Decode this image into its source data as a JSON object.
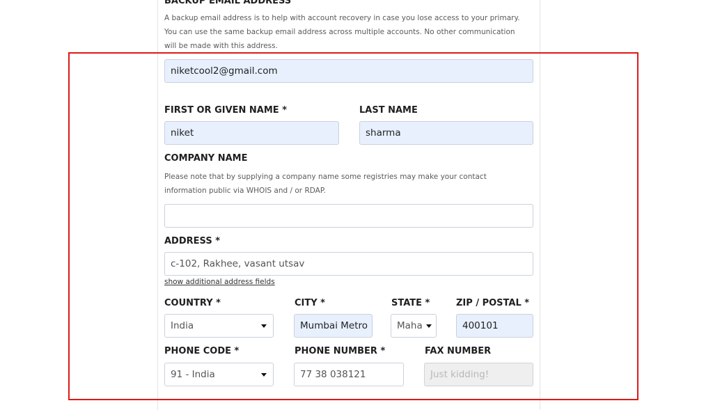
{
  "backup_email": {
    "heading": "BACKUP EMAIL ADDRESS",
    "help_line1": "A backup email address is to help with account recovery in case you lose access to your primary.",
    "help_line2": "You can use the same backup email address across multiple accounts. No other communication",
    "help_line3": "will be made with this address.",
    "value": "niketcool2@gmail.com"
  },
  "first_name": {
    "label": "FIRST OR GIVEN NAME *",
    "value": "niket"
  },
  "last_name": {
    "label": "LAST NAME",
    "value": "sharma"
  },
  "company": {
    "label": "COMPANY NAME",
    "help_line1": "Please note that by supplying a company name some registries may make your contact",
    "help_line2": "information public via WHOIS and / or RDAP.",
    "value": ""
  },
  "address": {
    "label": "ADDRESS *",
    "value": "c-102, Rakhee, vasant utsav",
    "more_link": "show additional address fields"
  },
  "country": {
    "label": "COUNTRY *",
    "value": "India"
  },
  "city": {
    "label": "CITY *",
    "value": "Mumbai Metro"
  },
  "state": {
    "label": "STATE *",
    "value": "Maha"
  },
  "zip": {
    "label": "ZIP / POSTAL *",
    "value": "400101"
  },
  "phone_code": {
    "label": "PHONE CODE *",
    "value": "91 - India"
  },
  "phone_number": {
    "label": "PHONE NUMBER *",
    "value": "77 38 038121"
  },
  "fax": {
    "label": "FAX NUMBER",
    "placeholder": "Just kidding!"
  },
  "colors": {
    "autofill_bg": "#e8f0fe",
    "highlight_border": "#e01818"
  }
}
